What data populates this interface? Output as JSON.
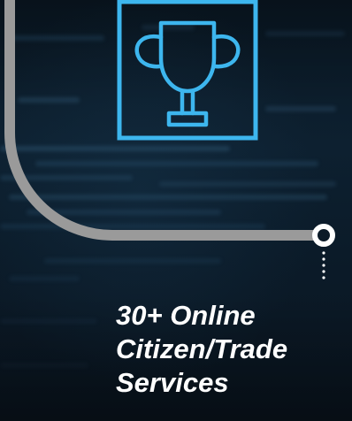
{
  "colors": {
    "accent": "#3db6ee",
    "connector": "#9a9a9a",
    "text": "#ffffff",
    "background": "#0b1a27"
  },
  "icon": "trophy-icon",
  "caption": {
    "line1": "30+ Online",
    "line2": "Citizen/Trade",
    "line3": "Services"
  }
}
